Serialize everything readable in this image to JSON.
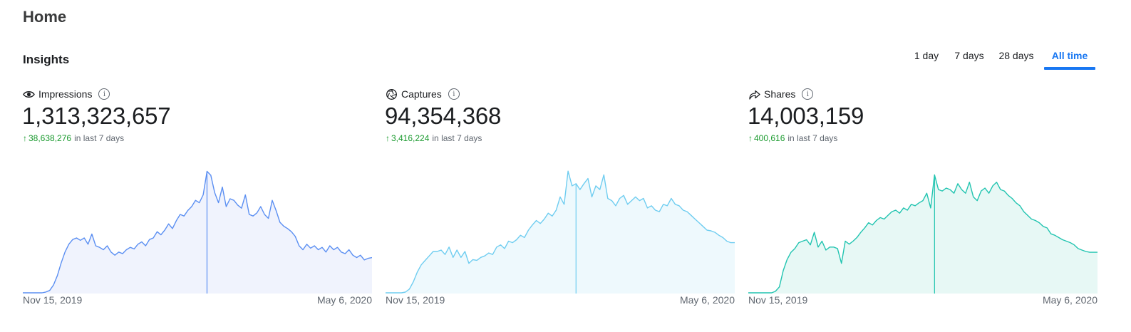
{
  "page": {
    "title": "Home"
  },
  "insights": {
    "title": "Insights",
    "tabs": [
      {
        "label": "1 day",
        "active": false
      },
      {
        "label": "7 days",
        "active": false
      },
      {
        "label": "28 days",
        "active": false
      },
      {
        "label": "All time",
        "active": true
      }
    ]
  },
  "colors": {
    "accent": "#1877f2",
    "positive": "#1a9a2e",
    "impressions_line": "#5b8ff2",
    "captures_line": "#6fcdf0",
    "shares_line": "#21c4b0"
  },
  "metrics": [
    {
      "label": "Impressions",
      "icon": "eye-icon",
      "value": "1,313,323,657",
      "delta": "38,638,276",
      "period": "in last 7 days",
      "date_start": "Nov 15, 2019",
      "date_end": "May 6, 2020"
    },
    {
      "label": "Captures",
      "icon": "aperture-icon",
      "value": "94,354,368",
      "delta": "3,416,224",
      "period": "in last 7 days",
      "date_start": "Nov 15, 2019",
      "date_end": "May 6, 2020"
    },
    {
      "label": "Shares",
      "icon": "share-arrow-icon",
      "value": "14,003,159",
      "delta": "400,616",
      "period": "in last 7 days",
      "date_start": "Nov 15, 2019",
      "date_end": "May 6, 2020"
    }
  ],
  "chart_data": [
    {
      "type": "area",
      "series": [
        {
          "name": "Impressions",
          "values": [
            0,
            0,
            0,
            0,
            0,
            0,
            1,
            3,
            10,
            22,
            38,
            52,
            62,
            68,
            70,
            67,
            70,
            62,
            75,
            60,
            58,
            55,
            60,
            52,
            48,
            52,
            50,
            55,
            58,
            56,
            62,
            65,
            60,
            68,
            70,
            78,
            74,
            80,
            88,
            82,
            92,
            100,
            98,
            105,
            110,
            118,
            115,
            125,
            155,
            150,
            128,
            115,
            135,
            110,
            120,
            118,
            112,
            108,
            125,
            100,
            98,
            102,
            110,
            100,
            95,
            118,
            105,
            90,
            85,
            82,
            78,
            72,
            60,
            55,
            62,
            57,
            60,
            55,
            58,
            52,
            60,
            55,
            58,
            52,
            50,
            55,
            48,
            45,
            48,
            42,
            44,
            45
          ]
        }
      ],
      "highlight_index": 48,
      "ylim": [
        0,
        160
      ]
    },
    {
      "type": "area",
      "series": [
        {
          "name": "Captures",
          "values": [
            0,
            0,
            0,
            0,
            0,
            1,
            5,
            15,
            28,
            38,
            44,
            50,
            56,
            56,
            58,
            52,
            62,
            48,
            58,
            48,
            56,
            40,
            45,
            44,
            48,
            50,
            54,
            52,
            62,
            65,
            60,
            70,
            68,
            72,
            78,
            75,
            85,
            92,
            98,
            94,
            100,
            108,
            104,
            112,
            130,
            120,
            165,
            145,
            148,
            140,
            148,
            155,
            130,
            145,
            140,
            160,
            128,
            125,
            118,
            128,
            132,
            120,
            125,
            130,
            125,
            128,
            115,
            118,
            112,
            110,
            120,
            118,
            128,
            120,
            118,
            112,
            110,
            105,
            100,
            95,
            90,
            85,
            84,
            82,
            78,
            75,
            70,
            68,
            68
          ]
        }
      ],
      "highlight_index": 48,
      "ylim": [
        0,
        170
      ]
    },
    {
      "type": "area",
      "series": [
        {
          "name": "Shares",
          "values": [
            0,
            0,
            0,
            0,
            0,
            0,
            0,
            2,
            8,
            30,
            45,
            55,
            60,
            68,
            70,
            72,
            65,
            82,
            62,
            70,
            58,
            62,
            62,
            60,
            40,
            70,
            66,
            70,
            75,
            82,
            88,
            95,
            92,
            98,
            102,
            100,
            105,
            110,
            112,
            108,
            115,
            112,
            120,
            118,
            122,
            125,
            135,
            115,
            160,
            140,
            138,
            142,
            140,
            135,
            148,
            140,
            135,
            150,
            130,
            125,
            138,
            142,
            135,
            145,
            150,
            140,
            138,
            132,
            128,
            122,
            118,
            110,
            105,
            100,
            98,
            95,
            90,
            88,
            80,
            78,
            75,
            72,
            70,
            68,
            65,
            60,
            58,
            56,
            55,
            55,
            55
          ]
        }
      ],
      "highlight_index": 48,
      "ylim": [
        0,
        170
      ]
    }
  ]
}
